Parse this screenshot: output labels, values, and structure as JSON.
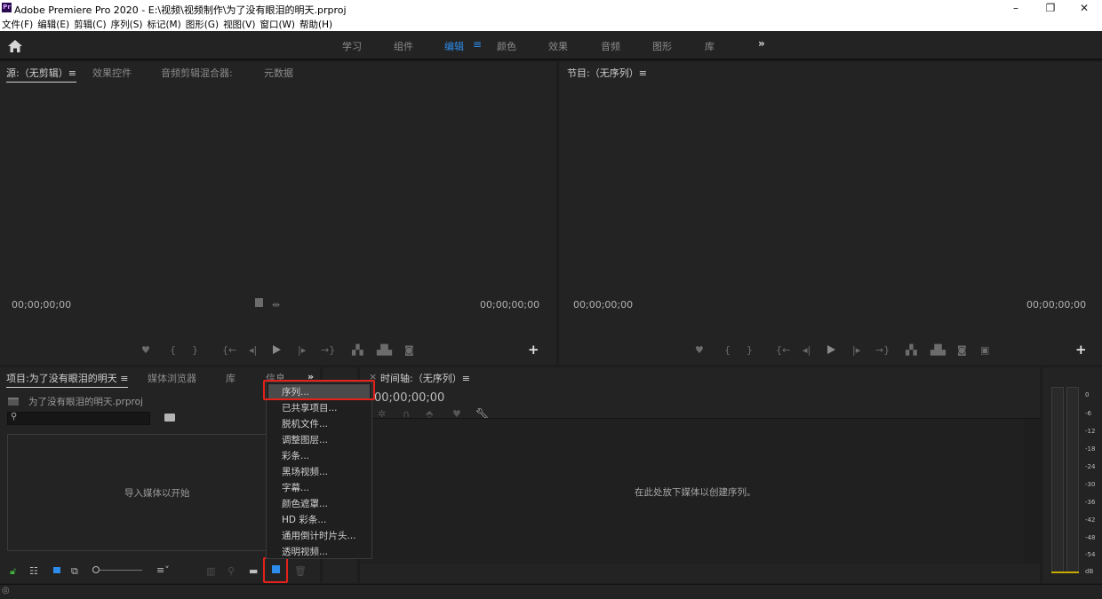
{
  "window": {
    "logo": "Pr",
    "title": "Adobe Premiere Pro 2020 - E:\\视频\\视频制作\\为了没有眼泪的明天.prproj",
    "minimize": "–",
    "maximize": "❐",
    "close": "✕"
  },
  "menubar": [
    "文件(F)",
    "编辑(E)",
    "剪辑(C)",
    "序列(S)",
    "标记(M)",
    "图形(G)",
    "视图(V)",
    "窗口(W)",
    "帮助(H)"
  ],
  "workspaces": {
    "items": [
      "学习",
      "组件",
      "编辑",
      "颜色",
      "效果",
      "音频",
      "图形",
      "库"
    ],
    "active": "编辑",
    "more": "»"
  },
  "source_panel": {
    "tabs": [
      "源:（无剪辑）≡",
      "效果控件",
      "音频剪辑混合器:",
      "元数据"
    ],
    "tc_left": "00;00;00;00",
    "tc_right": "00;00;00;00"
  },
  "program_panel": {
    "tab": "节目:（无序列）≡",
    "tc_left": "00;00;00;00",
    "tc_right": "00;00;00;00"
  },
  "project_panel": {
    "tabs": [
      "项目:为了没有眼泪的明天 ≡",
      "媒体浏览器",
      "库",
      "信息"
    ],
    "more": "»",
    "file_name": "为了没有眼泪的明天.prproj",
    "search_placeholder": "",
    "empty_text": "导入媒体以开始"
  },
  "timeline_panel": {
    "close": "×",
    "tab": "时间轴:（无序列）≡",
    "timecode": "00;00;00;00",
    "empty_text": "在此处放下媒体以创建序列。"
  },
  "context_menu": {
    "items": [
      "序列...",
      "已共享项目...",
      "脱机文件...",
      "调整图层...",
      "彩条...",
      "黑场视频...",
      "字幕...",
      "颜色遮罩...",
      "HD 彩条...",
      "通用倒计时片头...",
      "透明视频..."
    ],
    "highlighted": "序列..."
  },
  "audio_meter": {
    "ticks": [
      "0",
      "-6",
      "-12",
      "-18",
      "-24",
      "-30",
      "-36",
      "-42",
      "-48",
      "-54",
      "dB"
    ]
  },
  "colors": {
    "accent": "#2d8ceb",
    "highlight_box": "#e3221a",
    "panel_bg": "#232323"
  }
}
